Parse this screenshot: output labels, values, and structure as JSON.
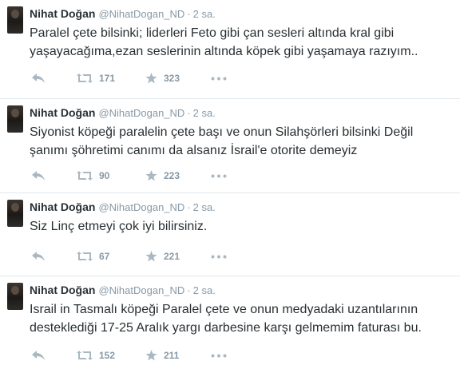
{
  "tweets": [
    {
      "name": "Nihat Doğan",
      "handle": "@NihatDogan_ND",
      "separator": "·",
      "time": "2 sa.",
      "text": "Paralel çete bilsinki; liderleri Feto gibi çan sesleri altında kral gibi yaşayacağıma,ezan seslerinin altında köpek gibi yaşamaya razıyım..",
      "retweets": "171",
      "favorites": "323"
    },
    {
      "name": "Nihat Doğan",
      "handle": "@NihatDogan_ND",
      "separator": "·",
      "time": "2 sa.",
      "text": "Siyonist köpeği paralelin çete başı ve onun Silahşörleri bilsinki Değil şanımı şöhretimi canımı da alsanız İsrail'e otorite demeyiz",
      "retweets": "90",
      "favorites": "223"
    },
    {
      "name": "Nihat Doğan",
      "handle": "@NihatDogan_ND",
      "separator": "·",
      "time": "2 sa.",
      "text": "Siz Linç etmeyi çok iyi bilirsiniz.",
      "retweets": "67",
      "favorites": "221"
    },
    {
      "name": "Nihat Doğan",
      "handle": "@NihatDogan_ND",
      "separator": "·",
      "time": "2 sa.",
      "text": "Israil in Tasmalı köpeği Paralel çete ve onun medyadaki uzantılarının desteklediği 17-25 Aralık yargı darbesine karşı gelmemim faturası bu.",
      "retweets": "152",
      "favorites": "211"
    }
  ],
  "icons": {
    "reply": "reply-arrow-icon",
    "retweet": "retweet-icon",
    "favorite": "star-icon",
    "more": "more-dots-icon",
    "icon_color": "#aab8c2"
  }
}
